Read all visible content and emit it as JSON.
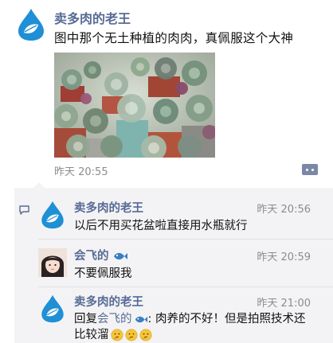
{
  "post": {
    "author": "卖多肉的老王",
    "text": "图中那个无土种植的肉肉，真佩服这个大神",
    "time": "昨天 20:55"
  },
  "comments": [
    {
      "author": "卖多肉的老王",
      "time": "昨天 20:56",
      "text": "以后不用买花盆啦直接用水瓶就行"
    },
    {
      "author": "会飞的",
      "time": "昨天 20:59",
      "text": "不要佩服我"
    },
    {
      "author": "卖多肉的老王",
      "time": "昨天 21:00",
      "reply_prefix": "回复",
      "reply_target": "会飞的",
      "reply_text": ": 肉养的不好！但是拍照技术还比较溜"
    }
  ],
  "icons": {
    "avatar": "water-drop-leaf-icon",
    "more": "more-dots-icon",
    "comment": "comment-bubble-icon",
    "fish": "fish-emoji-icon",
    "thinking": "thinking-face-emoji-icon"
  },
  "colors": {
    "name": "#576b95",
    "time": "#8c8c8c",
    "comment_bg": "#f3f3f5"
  }
}
